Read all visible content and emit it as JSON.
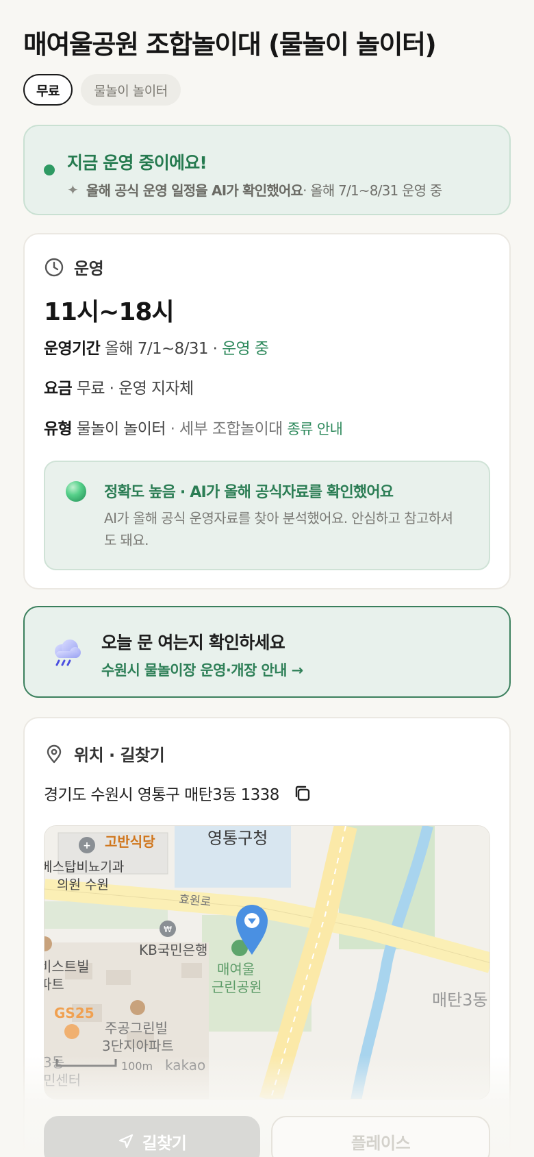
{
  "header": {
    "title": "매여울공원 조합놀이대 (물놀이 놀이터)",
    "chips": [
      "무료",
      "물놀이 놀이터"
    ]
  },
  "status": {
    "title": "지금 운영 중이에요!",
    "ai_note": "올해 공식 운영 일정을 AI가 확인했어요",
    "period_note": " · 올해 7/1~8/31 운영 중"
  },
  "operation": {
    "section_label": "운영",
    "hours": "11시~18시",
    "period_key": "운영기간",
    "period_value": " 올해 7/1~8/31 ·",
    "period_status": " 운영 중",
    "fee_key": "요금",
    "fee_value": " 무료 · 운영 지자체",
    "type_key": "유형",
    "type_value": " 물놀이 놀이터",
    "type_detail": " · 세부 조합놀이대 ",
    "type_link": "종류 안내",
    "accuracy_title": "정확도 높음 · AI가 올해 공식자료를 확인했어요",
    "accuracy_desc": "AI가 올해 공식 운영자료를 찾아 분석했어요. 안심하고 참고하셔도 돼요."
  },
  "cta": {
    "title": "오늘 문 여는지 확인하세요",
    "link": "수원시 물놀이장 운영·개장 안내 →"
  },
  "location": {
    "section_label": "위치 · 길찾기",
    "address": "경기도 수원시 영통구 매탄3동 1338"
  },
  "map": {
    "labels": {
      "restaurant": "고반식당",
      "district_office": "영통구청",
      "clinic_line1": "베스탑비뇨기과",
      "clinic_line2": "의원 수원",
      "road": "효원로",
      "bank": "KB국민은행",
      "villa_line1": "비스트빌",
      "villa_line2": "파트",
      "park_line1": "매여울",
      "park_line2": "근린공원",
      "area": "매탄3동",
      "store": "GS25",
      "apt_line1": "주공그린빌",
      "apt_line2": "3단지아파트",
      "edge_line1": "3동",
      "edge_line2": "민센터",
      "scale": "100m",
      "provider": "kakao"
    }
  },
  "actions": {
    "directions": "길찾기",
    "place": "플레이스"
  },
  "colors": {
    "accent_green": "#2f8a5d",
    "status_bg": "#e8f1ec",
    "marker_blue": "#4a90e2"
  }
}
